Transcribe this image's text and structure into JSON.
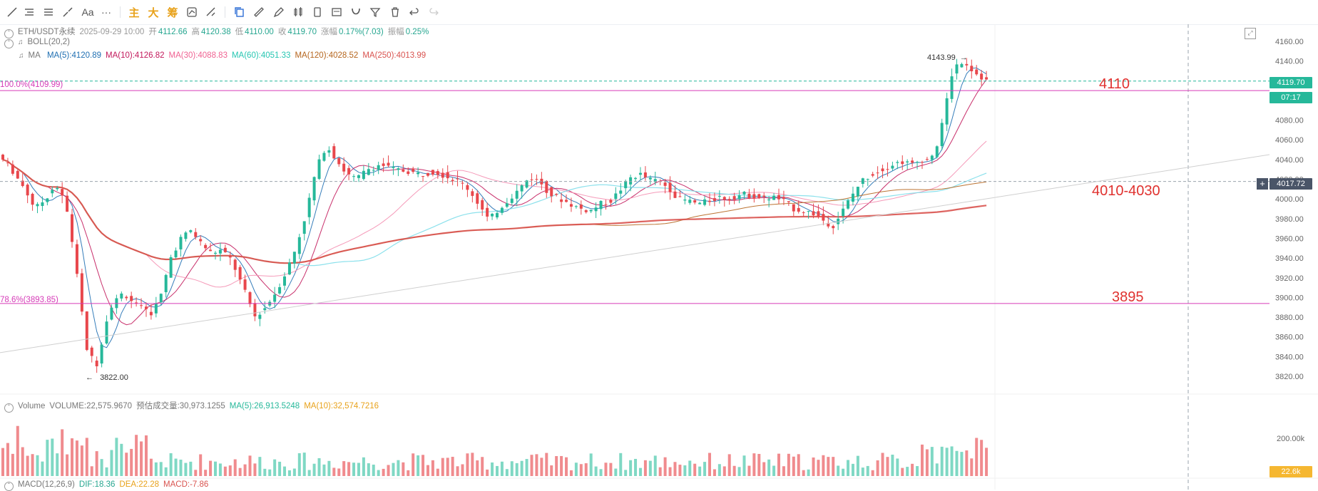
{
  "toolbar": {
    "items": [
      "line-tool",
      "horizontal-ray-tool",
      "parallel-lines-tool",
      "brush-tool",
      "text-tool",
      "more-tool",
      "main-chart-button",
      "large-order-button",
      "chip-button",
      "indicator-tool",
      "strategy-tool",
      "drawing-toggle",
      "copy-tool",
      "ruler-tool",
      "pen-tool",
      "candle-type-tool",
      "phone-tool",
      "note-tool",
      "magnet-tool",
      "filter-tool",
      "delete-tool",
      "undo-tool",
      "redo-tool"
    ],
    "text_aa": "Aa",
    "text_more": "···",
    "text_main": "主",
    "text_big": "大",
    "text_chip": "筹"
  },
  "info": {
    "symbol": "ETH/USDT永续",
    "datetime": "2025-09-29 10:00",
    "open_label": "开",
    "open": "4112.66",
    "high_label": "高",
    "high": "4120.38",
    "low_label": "低",
    "low": "4110.00",
    "close_label": "收",
    "close": "4119.70",
    "change_label": "涨幅",
    "change": "0.17%(7.03)",
    "amp_label": "振幅",
    "amp": "0.25%"
  },
  "boll": "BOLL(20,2)",
  "ma": {
    "label": "MA",
    "items": [
      {
        "text": "MA(5):4120.89",
        "color": "#1f6fb2"
      },
      {
        "text": "MA(10):4126.82",
        "color": "#c2185b"
      },
      {
        "text": "MA(30):4088.83",
        "color": "#f06292"
      },
      {
        "text": "MA(60):4051.33",
        "color": "#26c6b2"
      },
      {
        "text": "MA(120):4028.52",
        "color": "#b5651d"
      },
      {
        "text": "MA(250):4013.99",
        "color": "#d9534f"
      }
    ]
  },
  "fib": {
    "top_label": "100.0%(4109.99)",
    "bottom_label": "78.6%(3893.85)",
    "color": "#d63bb8"
  },
  "levels": {
    "l1": "4110",
    "l2": "4010-4030",
    "l3": "3895"
  },
  "markers": {
    "high": "4143.99",
    "low": "3822.00"
  },
  "price_axis": {
    "ticks": [
      "4160.00",
      "4140.00",
      "4120.00",
      "4100.00",
      "4080.00",
      "4060.00",
      "4040.00",
      "4020.00",
      "4000.00",
      "3980.00",
      "3960.00",
      "3940.00",
      "3920.00",
      "3900.00",
      "3880.00",
      "3860.00",
      "3840.00",
      "3820.00"
    ],
    "last_price": "4119.70",
    "countdown": "07:17",
    "crosshair_price": "4017.72"
  },
  "volume": {
    "label": "Volume",
    "volume": "VOLUME:22,575.9670",
    "est_label": "预估成交量:30,973.1255",
    "ma5": "MA(5):26,913.5248",
    "ma10": "MA(10):32,574.7216",
    "tick": "200.00k",
    "last": "22.6k"
  },
  "macd": {
    "label": "MACD(12,26,9)",
    "dif": "DIF:18.36",
    "dea": "DEA:22.28",
    "macd": "MACD:-7.86"
  },
  "chart_data": {
    "type": "candlestick",
    "symbol": "ETH/USDT永续",
    "ylim": [
      3810,
      4170
    ],
    "colors": {
      "up": "#26b89a",
      "down": "#e8474c"
    },
    "price_path": [
      [
        0,
        4045
      ],
      [
        8,
        4030
      ],
      [
        16,
        4010
      ],
      [
        22,
        3990
      ],
      [
        28,
        4000
      ],
      [
        34,
        4015
      ],
      [
        40,
        3995
      ],
      [
        46,
        3935
      ],
      [
        52,
        3850
      ],
      [
        58,
        3830
      ],
      [
        66,
        3890
      ],
      [
        74,
        3905
      ],
      [
        82,
        3892
      ],
      [
        90,
        3883
      ],
      [
        96,
        3900
      ],
      [
        102,
        3940
      ],
      [
        108,
        3960
      ],
      [
        114,
        3968
      ],
      [
        120,
        3955
      ],
      [
        126,
        3945
      ],
      [
        132,
        3948
      ],
      [
        138,
        3938
      ],
      [
        146,
        3905
      ],
      [
        152,
        3880
      ],
      [
        158,
        3890
      ],
      [
        164,
        3905
      ],
      [
        170,
        3925
      ],
      [
        176,
        3950
      ],
      [
        182,
        3985
      ],
      [
        188,
        4030
      ],
      [
        194,
        4055
      ],
      [
        200,
        4040
      ],
      [
        206,
        4025
      ],
      [
        212,
        4020
      ],
      [
        218,
        4030
      ],
      [
        226,
        4035
      ],
      [
        234,
        4030
      ],
      [
        242,
        4028
      ],
      [
        250,
        4025
      ],
      [
        258,
        4028
      ],
      [
        266,
        4022
      ],
      [
        272,
        4018
      ],
      [
        278,
        4010
      ],
      [
        284,
        3995
      ],
      [
        290,
        3978
      ],
      [
        296,
        3990
      ],
      [
        302,
        4000
      ],
      [
        308,
        4010
      ],
      [
        314,
        4022
      ],
      [
        320,
        4018
      ],
      [
        326,
        4005
      ],
      [
        332,
        4000
      ],
      [
        338,
        3995
      ],
      [
        344,
        3990
      ],
      [
        350,
        3988
      ],
      [
        356,
        3995
      ],
      [
        362,
        3998
      ],
      [
        368,
        4010
      ],
      [
        374,
        4022
      ],
      [
        380,
        4025
      ],
      [
        384,
        4020
      ],
      [
        390,
        4018
      ],
      [
        396,
        4012
      ],
      [
        402,
        4000
      ],
      [
        408,
        3998
      ],
      [
        414,
        3995
      ],
      [
        420,
        3998
      ],
      [
        426,
        4002
      ],
      [
        432,
        4000
      ],
      [
        440,
        4005
      ],
      [
        446,
        4003
      ],
      [
        452,
        4000
      ],
      [
        458,
        4002
      ],
      [
        464,
        3998
      ],
      [
        470,
        3990
      ],
      [
        476,
        3988
      ],
      [
        482,
        3985
      ],
      [
        488,
        3978
      ],
      [
        493,
        3972
      ],
      [
        498,
        3985
      ],
      [
        504,
        4002
      ],
      [
        510,
        4018
      ],
      [
        516,
        4025
      ],
      [
        522,
        4030
      ],
      [
        528,
        4035
      ],
      [
        534,
        4038
      ],
      [
        540,
        4035
      ],
      [
        546,
        4040
      ],
      [
        552,
        4045
      ],
      [
        556,
        4060
      ],
      [
        560,
        4095
      ],
      [
        564,
        4130
      ],
      [
        568,
        4140
      ],
      [
        572,
        4138
      ],
      [
        576,
        4130
      ],
      [
        580,
        4125
      ],
      [
        584,
        4120
      ]
    ],
    "markers": {
      "high": 4143.99,
      "low": 3822.0
    },
    "horizontal_levels": [
      4110,
      3895
    ],
    "crosshair": 4017.72,
    "last_price": 4119.7
  }
}
